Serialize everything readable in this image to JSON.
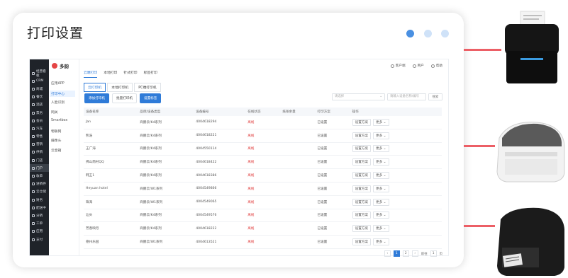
{
  "card": {
    "title": "打印设置"
  },
  "nav": {
    "items": [
      "经营看板",
      "CRM",
      "商城",
      "餐饮",
      "酒店",
      "票务",
      "会员",
      "汽车",
      "零售",
      "营销",
      "供销",
      "门店",
      "门户",
      "收单",
      "进销存",
      "云仓储",
      "财务",
      "配送中",
      "分销",
      "工单",
      "应用",
      "支付"
    ],
    "active_index": 12
  },
  "sub_nav": {
    "brand": "多韵",
    "items": [
      "应用APP",
      "打印中心",
      "人脸识别",
      "网关",
      "Smartbox",
      "物联网",
      "摄像头",
      "云音箱"
    ],
    "active_index": 1
  },
  "header": {
    "items": [
      {
        "label": "客户端"
      },
      {
        "label": "用户"
      },
      {
        "label": "帮助"
      }
    ]
  },
  "tabs_top": {
    "items": [
      "云端打印",
      "本地打印",
      "针式打印",
      "标签打印"
    ],
    "active_index": 0
  },
  "tabs_printer": {
    "items": [
      "云打印机",
      "本地打印机",
      "PC端打印机"
    ],
    "active_index": 0
  },
  "buttons": {
    "add": "添加打印机",
    "bulk": "批量打印机",
    "settings": "设置标签"
  },
  "filters": {
    "select_placeholder": "请选择",
    "input_placeholder": "请输入设备名称/编号",
    "search": "搜索"
  },
  "table": {
    "columns": [
      "设备名称",
      "品牌/设备类型",
      "设备编号",
      "在线状态",
      "纸张余量",
      "打印方案",
      "操作"
    ],
    "rows": [
      [
        "Jan",
        "商鹏云/K4系列",
        "4004618294",
        "离线",
        "",
        "已设置",
        "设置方案",
        "更多"
      ],
      [
        "熊浩",
        "商鹏云/K4系列",
        "4004618221",
        "离线",
        "",
        "已设置",
        "设置方案",
        "更多"
      ],
      [
        "王广海",
        "商鹏云/K4系列",
        "4004550114",
        "离线",
        "",
        "已设置",
        "设置方案",
        "更多"
      ],
      [
        "佛山南村QQ",
        "商鹏云/K4系列",
        "4004618422",
        "离线",
        "",
        "已设置",
        "设置方案",
        "更多"
      ],
      [
        "韩王1",
        "商鹏云/K4系列",
        "4004618386",
        "离线",
        "",
        "已设置",
        "设置方案",
        "更多"
      ],
      [
        "Heyuan hotel",
        "商鹏云/W1系列",
        "4004549866",
        "离线",
        "",
        "已设置",
        "设置方案",
        "更多"
      ],
      [
        "珠海",
        "商鹏云/W1系列",
        "4004549065",
        "离线",
        "",
        "已设置",
        "设置方案",
        "更多"
      ],
      [
        "汕头",
        "商鹏云/K4系列",
        "4004549576",
        "离线",
        "",
        "已设置",
        "设置方案",
        "更多"
      ],
      [
        "芳香映月",
        "商鹏云/K4系列",
        "4004618222",
        "离线",
        "",
        "已设置",
        "设置方案",
        "更多"
      ],
      [
        "德州乐园",
        "商鹏云/W1系列",
        "4004613521",
        "离线",
        "",
        "已设置",
        "设置方案",
        "更多"
      ]
    ]
  },
  "pager": {
    "prev": "‹",
    "pages": [
      "1",
      "2"
    ],
    "active_index": 0,
    "next": "›",
    "goto_label": "前往",
    "goto_value": "1",
    "page_suffix": "页"
  },
  "colors": {
    "accent": "#2f7bd8",
    "danger": "#e03c3c",
    "nav_bg": "#1f2329",
    "connector": "#ec5f66"
  }
}
